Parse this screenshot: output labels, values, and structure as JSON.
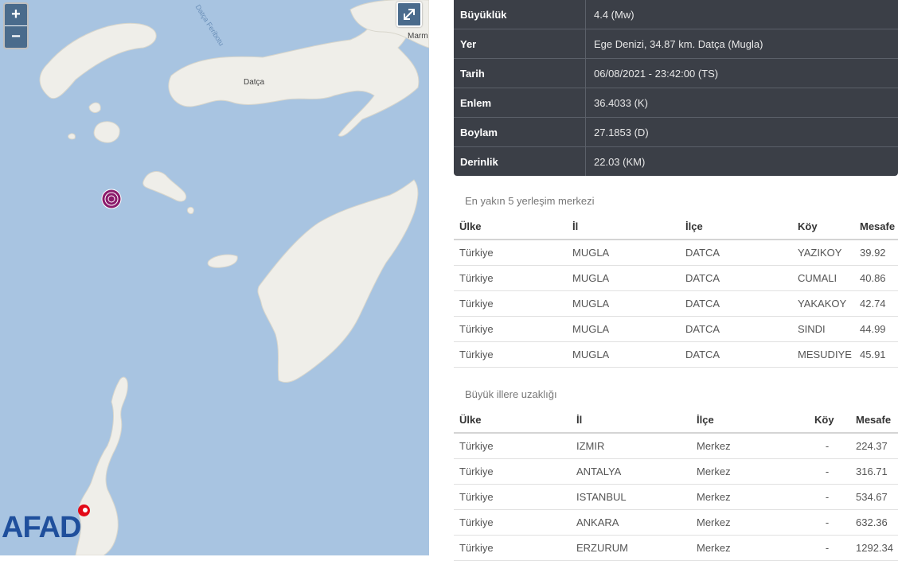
{
  "map": {
    "city_label": "Datça",
    "city_label_right": "Marm",
    "strait_label": "Datça Feribotu",
    "zoom_in": "+",
    "zoom_out": "−",
    "logo_text": "AFAD"
  },
  "details": [
    {
      "label": "Büyüklük",
      "value": "4.4 (Mw)"
    },
    {
      "label": "Yer",
      "value": "Ege Denizi, 34.87 km. Datça (Mugla)"
    },
    {
      "label": "Tarih",
      "value": "06/08/2021 - 23:42:00 (TS)"
    },
    {
      "label": "Enlem",
      "value": "36.4033 (K)"
    },
    {
      "label": "Boylam",
      "value": "27.1853 (D)"
    },
    {
      "label": "Derinlik",
      "value": "22.03 (KM)"
    }
  ],
  "nearest": {
    "title": "En yakın 5 yerleşim merkezi",
    "headers": [
      "Ülke",
      "İl",
      "İlçe",
      "Köy",
      "Mesafe"
    ],
    "rows": [
      [
        "Türkiye",
        "MUGLA",
        "DATCA",
        "YAZIKOY",
        "39.92"
      ],
      [
        "Türkiye",
        "MUGLA",
        "DATCA",
        "CUMALI",
        "40.86"
      ],
      [
        "Türkiye",
        "MUGLA",
        "DATCA",
        "YAKAKOY",
        "42.74"
      ],
      [
        "Türkiye",
        "MUGLA",
        "DATCA",
        "SINDI",
        "44.99"
      ],
      [
        "Türkiye",
        "MUGLA",
        "DATCA",
        "MESUDIYE",
        "45.91"
      ]
    ]
  },
  "cities": {
    "title": "Büyük illere uzaklığı",
    "headers": [
      "Ülke",
      "İl",
      "İlçe",
      "Köy",
      "Mesafe"
    ],
    "rows": [
      [
        "Türkiye",
        "IZMIR",
        "Merkez",
        "-",
        "224.37"
      ],
      [
        "Türkiye",
        "ANTALYA",
        "Merkez",
        "-",
        "316.71"
      ],
      [
        "Türkiye",
        "ISTANBUL",
        "Merkez",
        "-",
        "534.67"
      ],
      [
        "Türkiye",
        "ANKARA",
        "Merkez",
        "-",
        "632.36"
      ],
      [
        "Türkiye",
        "ERZURUM",
        "Merkez",
        "-",
        "1292.34"
      ]
    ]
  },
  "colors": {
    "sea": "#a8c4e1",
    "land": "#efeee9",
    "epicenter": "#8b1a6b",
    "control": "#4a6b8c",
    "table_dark": "#3b3f47"
  }
}
